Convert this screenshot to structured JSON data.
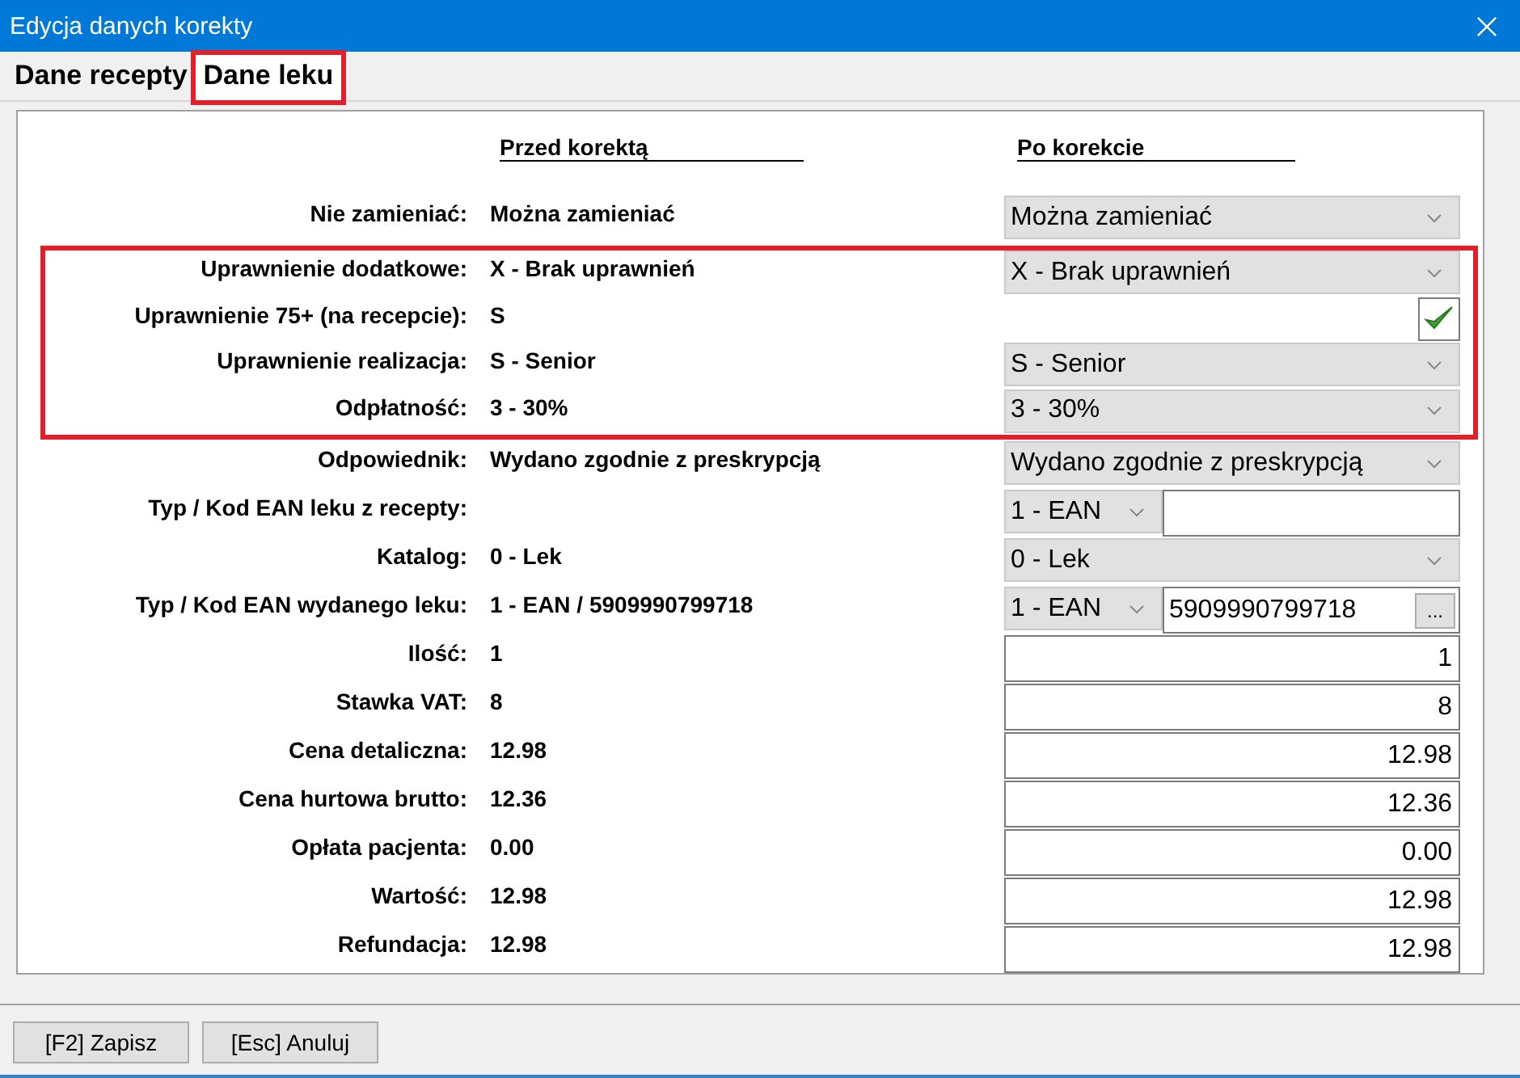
{
  "window": {
    "title": "Edycja danych korekty"
  },
  "tabs": [
    {
      "label": "Dane recepty",
      "selected": false,
      "highlighted": false
    },
    {
      "label": "Dane leku",
      "selected": true,
      "highlighted": true
    }
  ],
  "headers": {
    "before": "Przed korektą",
    "after": "Po korekcie"
  },
  "sections": [
    {
      "highlighted": false,
      "rows": [
        {
          "label": "Nie zamieniać:",
          "before": "Można zamieniać",
          "after": {
            "kind": "select",
            "value": "Można zamieniać"
          }
        }
      ]
    },
    {
      "highlighted": true,
      "rows": [
        {
          "label": "Uprawnienie dodatkowe:",
          "before": "X - Brak uprawnień",
          "after": {
            "kind": "select",
            "value": "X - Brak uprawnień"
          }
        },
        {
          "label": "Uprawnienie 75+ (na recepcie):",
          "before": "S",
          "after": {
            "kind": "check",
            "checked": true
          }
        },
        {
          "label": "Uprawnienie realizacja:",
          "before": "S - Senior",
          "after": {
            "kind": "select",
            "value": "S - Senior"
          }
        },
        {
          "label": "Odpłatność:",
          "before": "3 - 30%",
          "after": {
            "kind": "select",
            "value": "3 - 30%"
          }
        }
      ]
    },
    {
      "highlighted": false,
      "rows": [
        {
          "label": "Odpowiednik:",
          "before": "Wydano zgodnie z preskrypcją",
          "after": {
            "kind": "select",
            "value": "Wydano zgodnie z preskrypcją"
          }
        },
        {
          "label": "Typ / Kod EAN leku z recepty:",
          "after": {
            "kind": "code",
            "type": "1 - EAN"
          }
        },
        {
          "label": "Katalog:",
          "before": "0 - Lek",
          "after": {
            "kind": "select",
            "value": "0 - Lek"
          }
        },
        {
          "label": "Typ / Kod EAN wydanego leku:",
          "before": "1 - EAN / 5909990799718",
          "after": {
            "kind": "code_button",
            "type": "1 - EAN",
            "value": "5909990799718",
            "button": "..."
          }
        },
        {
          "label": "Ilość:",
          "before": "1",
          "after": {
            "kind": "number",
            "value": "1"
          }
        },
        {
          "label": "Stawka VAT:",
          "before": "8",
          "after": {
            "kind": "number",
            "value": "8"
          }
        },
        {
          "label": "Cena detaliczna:",
          "before": "12.98",
          "after": {
            "kind": "number",
            "value": "12.98"
          }
        },
        {
          "label": "Cena hurtowa brutto:",
          "before": "12.36",
          "after": {
            "kind": "number",
            "value": "12.36"
          }
        },
        {
          "label": "Opłata pacjenta:",
          "before": "0.00",
          "after": {
            "kind": "number",
            "value": "0.00"
          }
        },
        {
          "label": "Wartość:",
          "before": "12.98",
          "after": {
            "kind": "number",
            "value": "12.98"
          }
        },
        {
          "label": "Refundacja:",
          "before": "12.98",
          "after": {
            "kind": "number",
            "value": "12.98"
          }
        }
      ]
    }
  ],
  "buttons": [
    "[F2] Zapisz",
    "[Esc] Anuluj"
  ]
}
